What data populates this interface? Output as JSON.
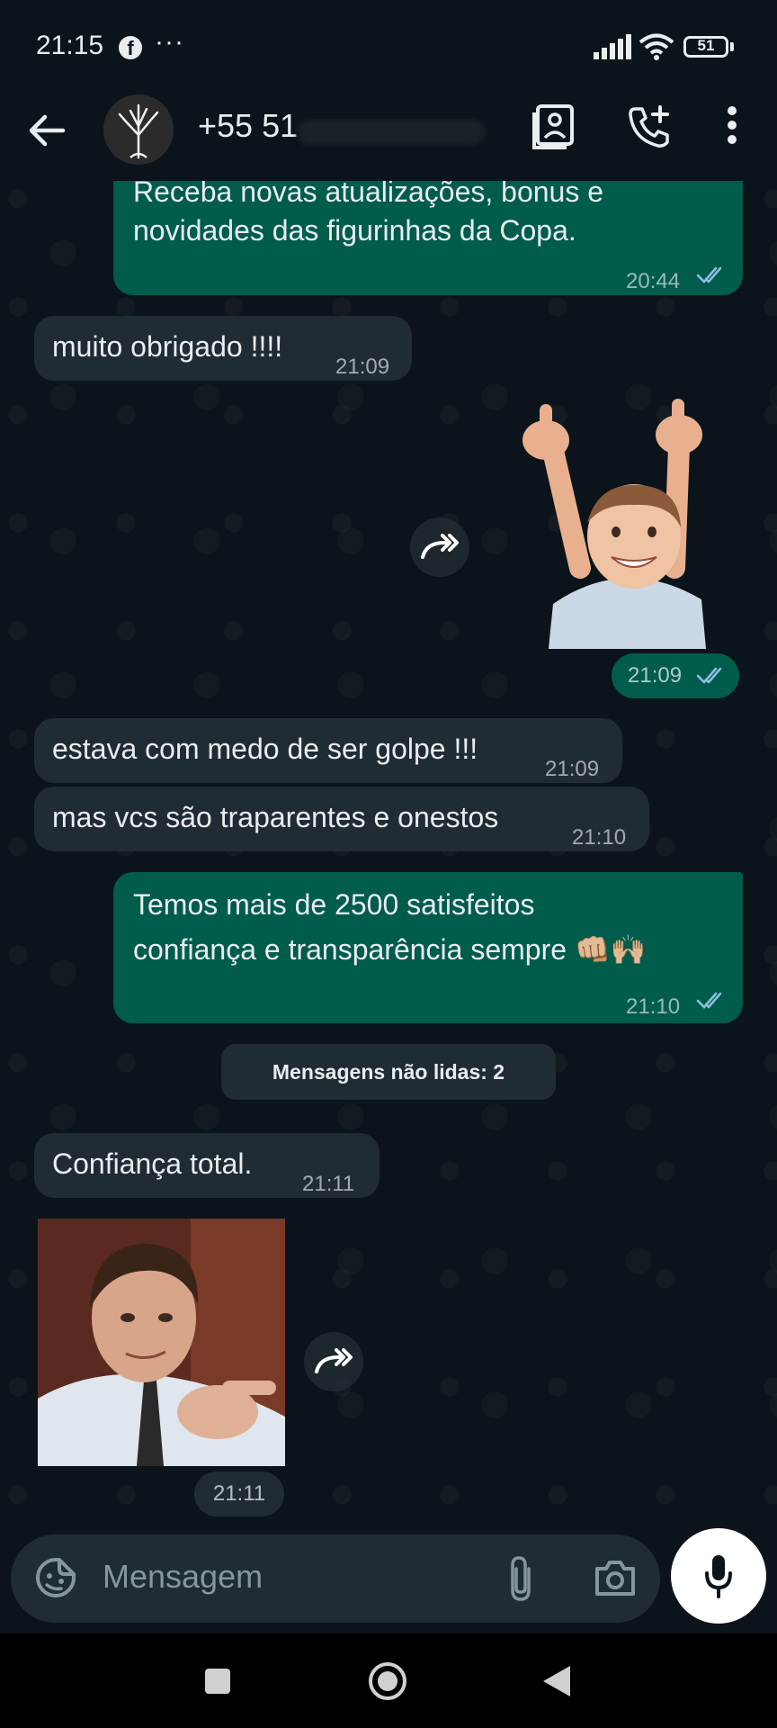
{
  "status_bar": {
    "time": "21:15",
    "app_icon": "facebook-icon",
    "more_indicator": "···",
    "battery_level": "51"
  },
  "header": {
    "contact_name": "+55 51",
    "icons": [
      "back-arrow-icon",
      "contact-card-icon",
      "add-call-icon",
      "overflow-menu-icon"
    ]
  },
  "messages": [
    {
      "direction": "out",
      "text_line1": "Receba novas atualizações, bonus e",
      "text_line2": "novidades das figurinhas da Copa.",
      "time": "20:44"
    },
    {
      "direction": "in",
      "text": "muito obrigado !!!!",
      "time": "21:09"
    },
    {
      "direction": "out",
      "type": "sticker",
      "description_icon": "thumbs-up-kid-sticker",
      "time": "21:09"
    },
    {
      "direction": "in",
      "text": "estava com medo de ser golpe !!!",
      "time": "21:09"
    },
    {
      "direction": "in",
      "text": "mas vcs são traparentes e onestos",
      "time": "21:10"
    },
    {
      "direction": "out",
      "text_line1": "Temos mais de 2500 satisfeitos",
      "text_line2": "confiança e transparência sempre 👊🏼🙌🏼",
      "time": "21:10"
    },
    {
      "direction": "in",
      "text": "Confiança total.",
      "time": "21:11"
    },
    {
      "direction": "in",
      "type": "sticker",
      "description_icon": "pointing-man-sticker",
      "time": "21:11"
    }
  ],
  "unread_banner": "Mensagens não lidas: 2",
  "input": {
    "placeholder": "Mensagem"
  },
  "colors": {
    "background": "#0b141a",
    "incoming_bubble": "#202c33",
    "outgoing_bubble": "#005c4b",
    "read_ticks": "#8fbfe0"
  }
}
